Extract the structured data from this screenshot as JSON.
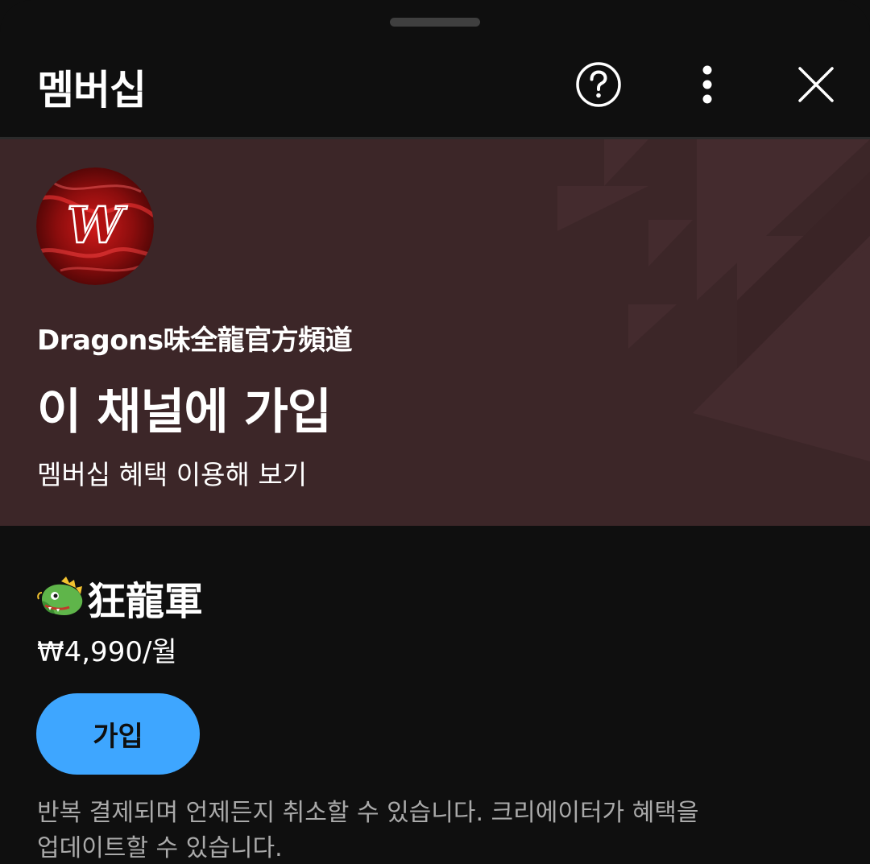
{
  "header": {
    "title": "멤버십",
    "help_icon": "help-circle-icon",
    "more_icon": "more-vertical-icon",
    "close_icon": "close-icon"
  },
  "banner": {
    "channel_name": "Dragons味全龍官方頻道",
    "title": "이 채널에 가입",
    "subtitle": "멤버십 혜택 이용해 보기",
    "background_color": "#3c2628"
  },
  "tier": {
    "emoji": "🐲",
    "name": "狂龍軍",
    "price": "₩4,990/월",
    "join_label": "가입",
    "accent_color": "#3ea6ff"
  },
  "disclaimer": {
    "line1": "반복 결제되며 언제든지 취소할 수 있습니다. 크리에이터가 혜택을",
    "line2": "업데이트할 수 있습니다."
  }
}
